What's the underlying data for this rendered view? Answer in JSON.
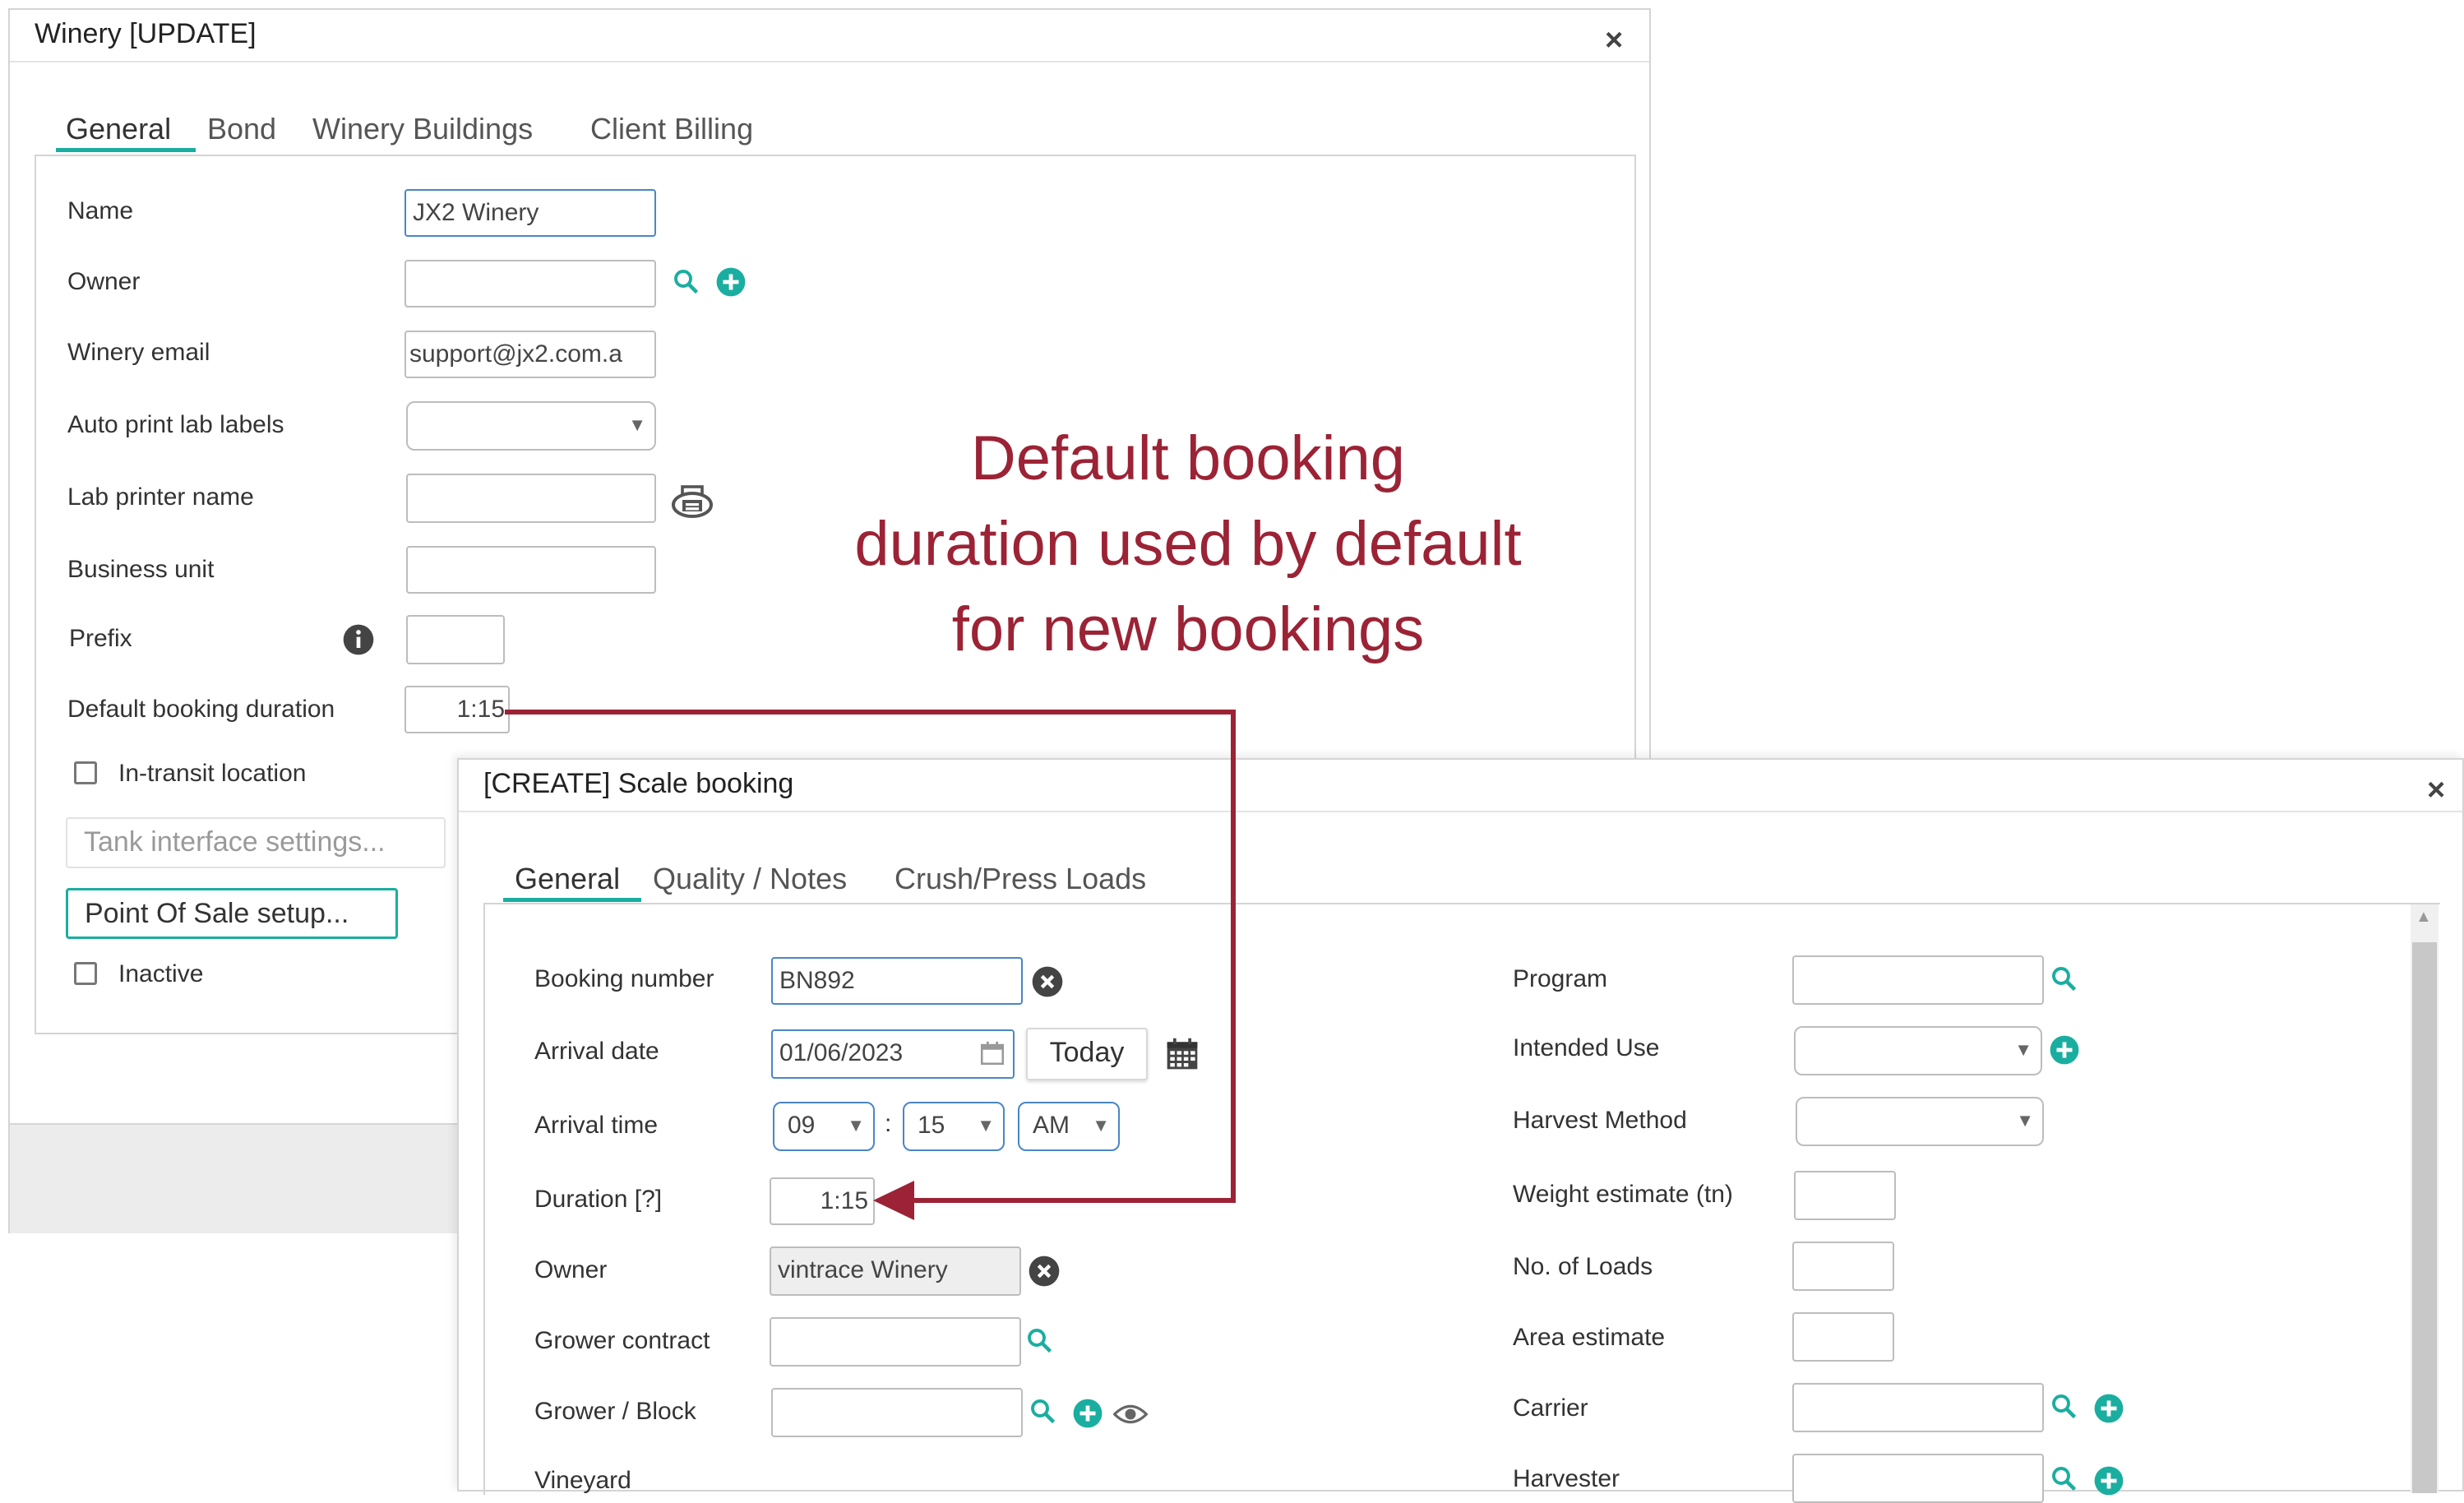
{
  "winery_dialog": {
    "title": "Winery [UPDATE]",
    "close": "×",
    "tabs": [
      "General",
      "Bond",
      "Winery Buildings",
      "Client Billing"
    ],
    "fields": {
      "name_label": "Name",
      "name_value": "JX2 Winery",
      "owner_label": "Owner",
      "owner_value": "",
      "email_label": "Winery email",
      "email_value": "support@jx2.com.a",
      "auto_print_label": "Auto print lab labels",
      "lab_printer_label": "Lab printer name",
      "business_unit_label": "Business unit",
      "prefix_label": "Prefix",
      "default_duration_label": "Default booking duration",
      "default_duration_value": "1:15",
      "in_transit_label": "In-transit location",
      "tank_interface_button": "Tank interface settings...",
      "pos_button": "Point Of Sale setup...",
      "inactive_label": "Inactive"
    }
  },
  "annotation": {
    "line1": "Default booking",
    "line2": "duration used by default",
    "line3": "for new bookings",
    "color": "#9b2335"
  },
  "booking_dialog": {
    "title": "[CREATE] Scale booking",
    "close": "×",
    "tabs": [
      "General",
      "Quality / Notes",
      "Crush/Press Loads"
    ],
    "left": {
      "booking_number_label": "Booking number",
      "booking_number_value": "BN892",
      "arrival_date_label": "Arrival date",
      "arrival_date_value": "01/06/2023",
      "today_button": "Today",
      "arrival_time_label": "Arrival time",
      "hour": "09",
      "minute": "15",
      "ampm": "AM",
      "time_sep": ":",
      "duration_label": "Duration [?]",
      "duration_value": "1:15",
      "owner_label": "Owner",
      "owner_value": "vintrace Winery",
      "grower_contract_label": "Grower contract",
      "grower_block_label": "Grower / Block",
      "vineyard_label": "Vineyard"
    },
    "right": {
      "program_label": "Program",
      "intended_use_label": "Intended Use",
      "harvest_method_label": "Harvest Method",
      "weight_estimate_label": "Weight estimate (tn)",
      "loads_label": "No. of Loads",
      "area_estimate_label": "Area estimate",
      "carrier_label": "Carrier",
      "harvester_label": "Harvester"
    }
  },
  "colors": {
    "accent": "#1aaea0",
    "focus_border": "#4a86c6",
    "annotation": "#9b2335"
  }
}
